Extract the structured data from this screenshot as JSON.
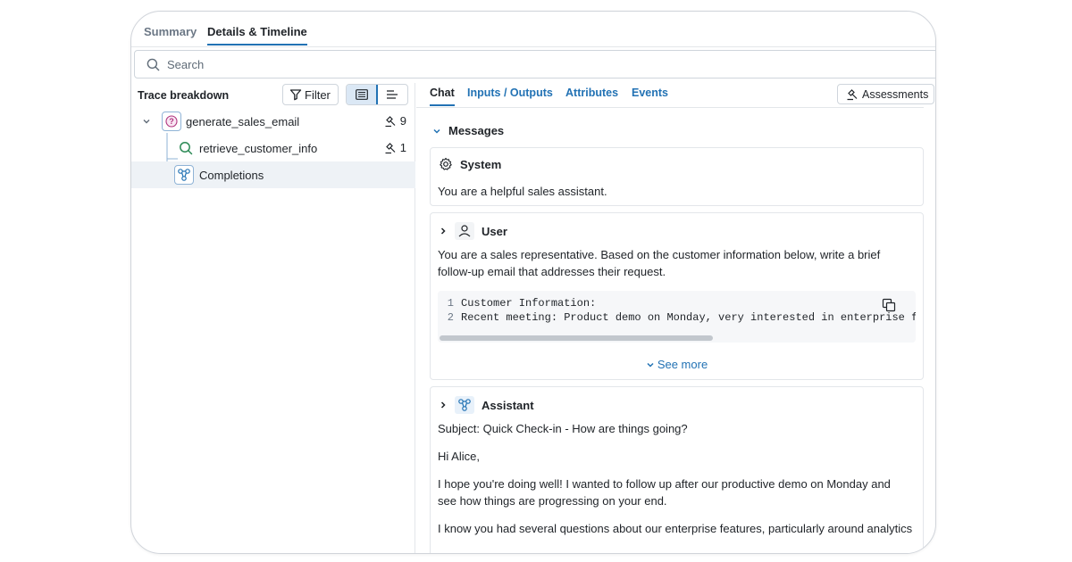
{
  "top_tabs": [
    {
      "label": "Summary",
      "active": false
    },
    {
      "label": "Details & Timeline",
      "active": true
    }
  ],
  "search": {
    "placeholder": "Search",
    "value": ""
  },
  "trace": {
    "title": "Trace breakdown",
    "filter_label": "Filter",
    "nodes": [
      {
        "label": "generate_sales_email",
        "badge": "9",
        "icon": "question-icon"
      },
      {
        "label": "retrieve_customer_info",
        "badge": "1",
        "icon": "search-icon"
      },
      {
        "label": "Completions",
        "badge": "",
        "icon": "completions-icon"
      }
    ]
  },
  "detail_tabs": [
    "Chat",
    "Inputs / Outputs",
    "Attributes",
    "Events"
  ],
  "assessments_label": "Assessments",
  "messages": {
    "title": "Messages",
    "system": {
      "role": "System",
      "text": "You are a helpful sales assistant."
    },
    "user": {
      "role": "User",
      "text": "You are a sales representative. Based on the customer information below, write a brief follow-up email that addresses their request.",
      "code_lines": [
        {
          "num": "1",
          "text": "Customer Information:"
        },
        {
          "num": "2",
          "text": "Recent meeting: Product demo on Monday, very interested in enterprise features"
        }
      ],
      "see_more": "See more"
    },
    "assistant": {
      "role": "Assistant",
      "p1": "Subject: Quick Check-in - How are things going?",
      "p2": "Hi Alice,",
      "p3": "I hope you're doing well! I wanted to follow up after our productive demo on Monday and see how things are progressing on your end.",
      "p4": "I know you had several questions about our enterprise features, particularly around analytics"
    }
  },
  "colors": {
    "accent": "#2272b4",
    "selected_row": "#eef2f6",
    "border": "#e3e6ea"
  }
}
